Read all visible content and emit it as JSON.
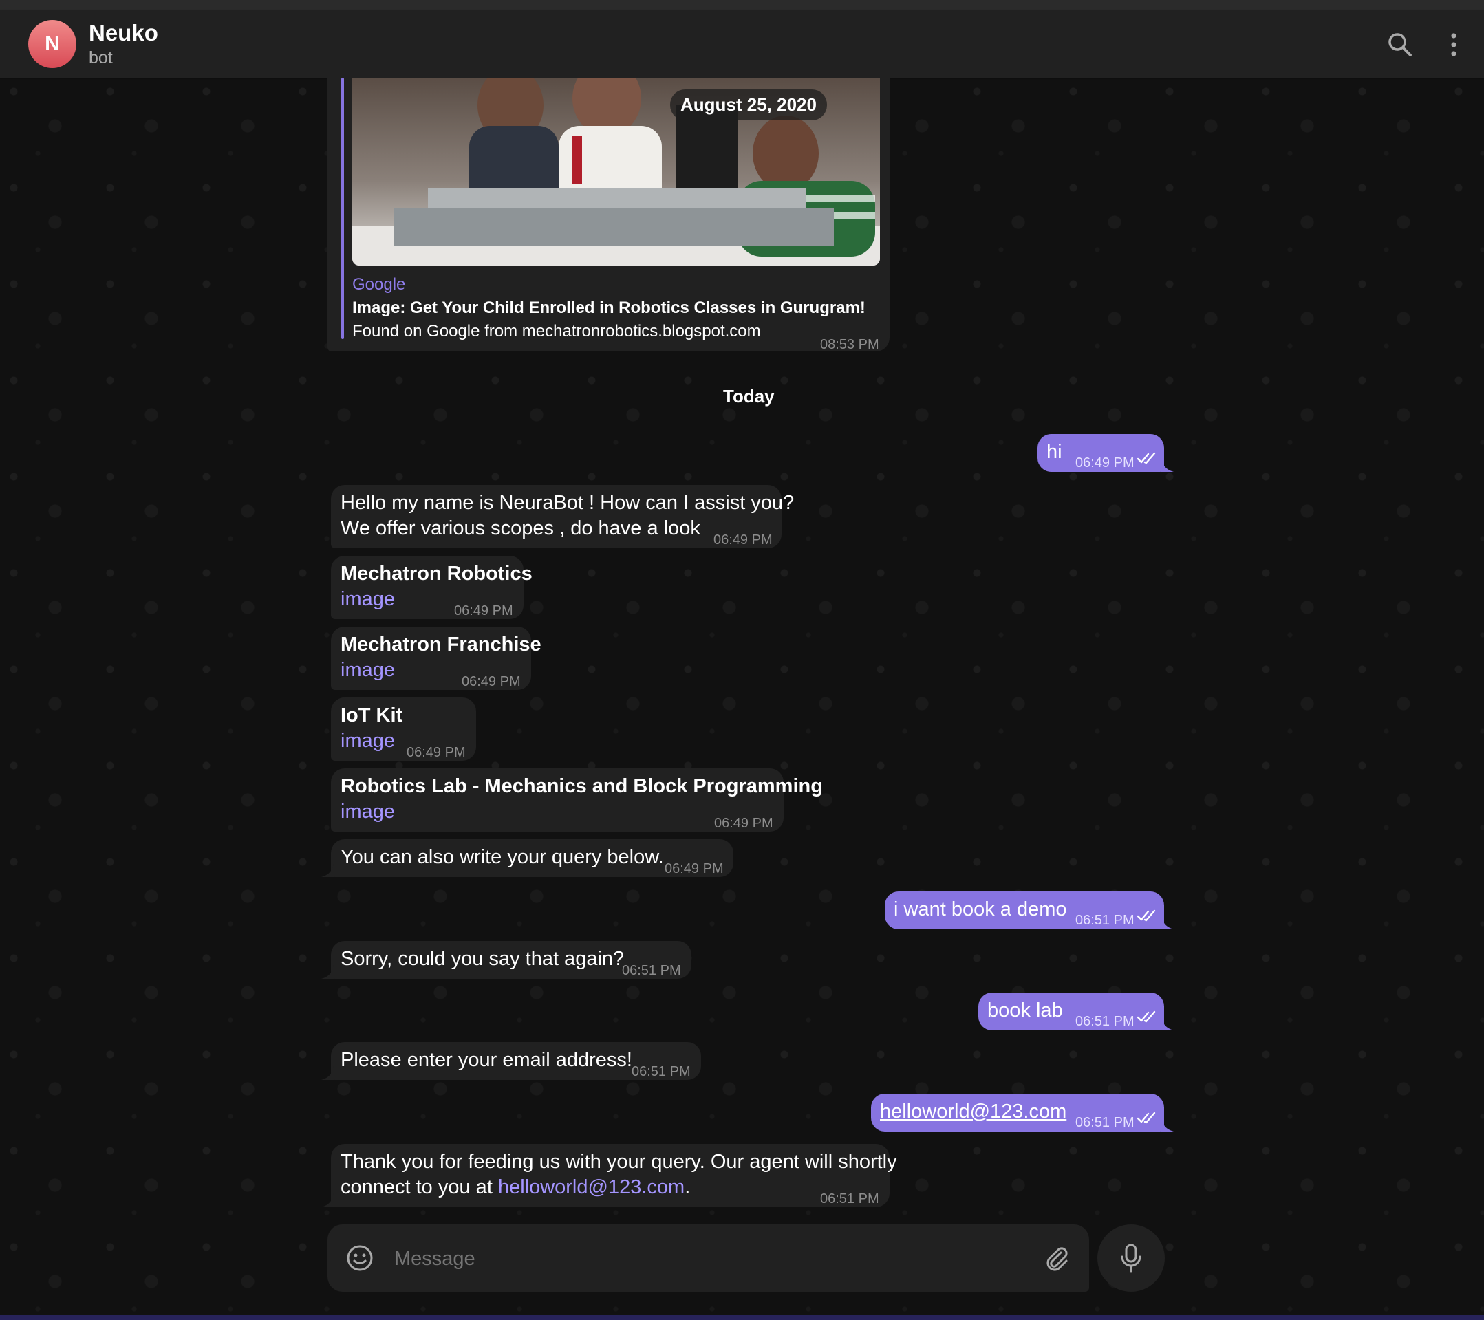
{
  "header": {
    "avatar_letter": "N",
    "title": "Neuko",
    "subtitle": "bot",
    "avatar_color": "#e2636a"
  },
  "accent_color": "#8774e1",
  "link_card": {
    "date_pill": "August 25, 2020",
    "site": "Google",
    "title": "Image: Get Your Child Enrolled in Robotics Classes in Gurugram!",
    "description": "Found on Google from mechatronrobotics.blogspot.com",
    "time": "08:53 PM"
  },
  "date_separator": "Today",
  "messages": [
    {
      "dir": "out",
      "text": "hi",
      "time": "06:49 PM"
    },
    {
      "dir": "in",
      "line1": "Hello my name is NeuraBot ! How can I assist you?",
      "line2": "We offer various scopes , do have a look",
      "time": "06:49 PM"
    },
    {
      "dir": "in",
      "title": "Mechatron Robotics",
      "link": "image",
      "time": "06:49 PM"
    },
    {
      "dir": "in",
      "title": "Mechatron Franchise",
      "link": "image",
      "time": "06:49 PM"
    },
    {
      "dir": "in",
      "title": "IoT Kit",
      "link": "image",
      "time": "06:49 PM"
    },
    {
      "dir": "in",
      "title": "Robotics Lab - Mechanics and Block Programming",
      "link": "image",
      "time": "06:49 PM"
    },
    {
      "dir": "in",
      "text": "You can also write your query below.",
      "time": "06:49 PM"
    },
    {
      "dir": "out",
      "text": "i want book a demo",
      "time": "06:51 PM"
    },
    {
      "dir": "in",
      "text": "Sorry, could you say that again?",
      "time": "06:51 PM"
    },
    {
      "dir": "out",
      "text": "book lab",
      "time": "06:51 PM"
    },
    {
      "dir": "in",
      "text": "Please enter your email address!",
      "time": "06:51 PM"
    },
    {
      "dir": "out",
      "text": "helloworld@123.com",
      "time": "06:51 PM"
    },
    {
      "dir": "in",
      "line1": "Thank you for feeding us with your query. Our agent will shortly",
      "line2_prefix": "connect to you at ",
      "line2_link": "helloworld@123.com",
      "line2_suffix": ".",
      "time": "06:51 PM"
    }
  ],
  "composer": {
    "placeholder": "Message",
    "icons": [
      "smile-icon",
      "paperclip-icon",
      "microphone-icon"
    ]
  },
  "header_icons": [
    "search-icon",
    "more-vertical-icon"
  ]
}
